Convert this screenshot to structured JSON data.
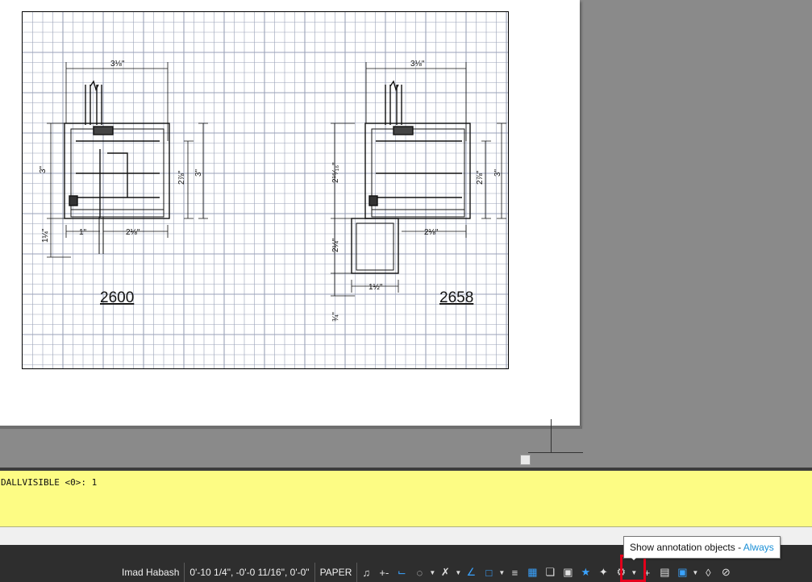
{
  "drawing": {
    "labels": [
      "2600",
      "2658"
    ],
    "dims_left": [
      "3⅛\"",
      "3\"",
      "2⅞\"",
      "3\"",
      "1¼\"",
      "1\"",
      "2⅛\""
    ],
    "dims_right": [
      "3⅛\"",
      "2¹⁵⁄₁₆\"",
      "2⅞\"",
      "3\"",
      "2¼\"",
      "2⅛\"",
      "1½\"",
      "¾\""
    ]
  },
  "command_line": {
    "text": "DALLVISIBLE <0>: 1"
  },
  "status_bar": {
    "user": "Imad Habash",
    "coordinates": "0'-10 1/4\", -0'-0 11/16\", 0'-0\"",
    "space": "PAPER",
    "icons": [
      "ortho-icon",
      "snap-icon",
      "ucs-icon",
      "polar-icon",
      "osnap-icon",
      "dynamic-ucs-icon",
      "workspace-icon",
      "lineweight-icon",
      "transparency-icon",
      "selection-cycle-icon",
      "annotation-monitor-icon",
      "show-annotation-objects-icon",
      "auto-scale-icon",
      "settings-icon",
      "add-icon",
      "quick-props-icon",
      "lock-icon",
      "isolate-icon",
      "clean-screen-icon"
    ],
    "accent": "#3aa3ff"
  },
  "tooltip": {
    "label": "Show annotation objects - ",
    "value": "Always"
  }
}
